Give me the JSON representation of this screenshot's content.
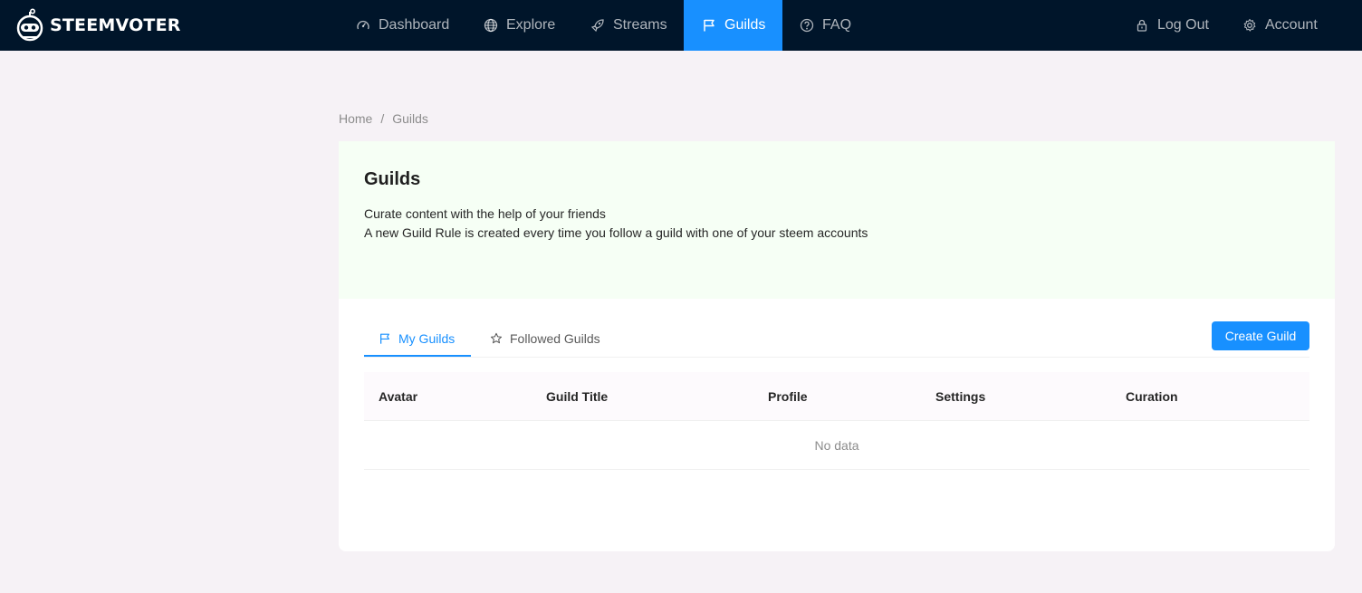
{
  "app": {
    "brand": "STEEMVOTER"
  },
  "nav": {
    "items": [
      {
        "label": "Dashboard",
        "icon": "dashboard-icon"
      },
      {
        "label": "Explore",
        "icon": "globe-icon"
      },
      {
        "label": "Streams",
        "icon": "rocket-icon"
      },
      {
        "label": "Guilds",
        "icon": "flag-icon",
        "active": true
      },
      {
        "label": "FAQ",
        "icon": "question-circle-icon"
      }
    ],
    "right": [
      {
        "label": "Log Out",
        "icon": "lock-icon"
      },
      {
        "label": "Account",
        "icon": "gear-icon"
      }
    ]
  },
  "breadcrumb": {
    "home": "Home",
    "separator": "/",
    "current": "Guilds"
  },
  "hero": {
    "title": "Guilds",
    "line1": "Curate content with the help of your friends",
    "line2": "A new Guild Rule is created every time you follow a guild with one of your steem accounts"
  },
  "tabs": [
    {
      "label": "My Guilds",
      "icon": "flag-icon",
      "active": true
    },
    {
      "label": "Followed Guilds",
      "icon": "star-icon",
      "active": false
    }
  ],
  "actions": {
    "create_guild": "Create Guild"
  },
  "table": {
    "columns": [
      "Avatar",
      "Guild Title",
      "Profile",
      "Settings",
      "Curation"
    ],
    "empty_text": "No data"
  },
  "colors": {
    "nav_bg": "#00152a",
    "accent": "#1890ff",
    "page_bg": "#f6f2f6",
    "hero_bg": "#f6fff5"
  }
}
